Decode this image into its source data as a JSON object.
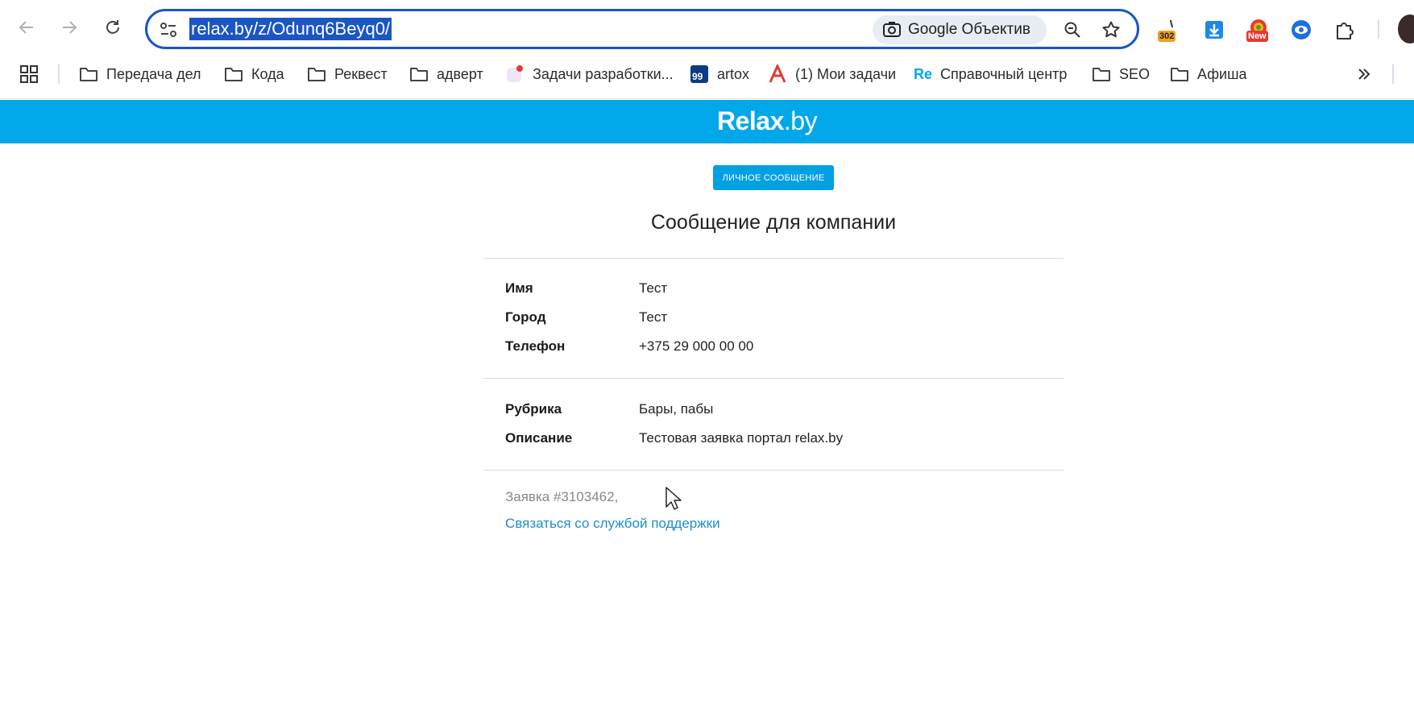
{
  "browser": {
    "url": "relax.by/z/Odunq6Beyq0/",
    "lens_label": "Google Объектив",
    "extensions": [
      {
        "name": "timer-extension",
        "badge": "302",
        "badge_color": "#f0a020"
      },
      {
        "name": "download-extension"
      },
      {
        "name": "new-extension",
        "badge": "New",
        "badge_color": "#e53935"
      },
      {
        "name": "eye-extension"
      },
      {
        "name": "puzzle-extension"
      }
    ]
  },
  "bookmarks": [
    {
      "label": "Передача дел",
      "icon": "folder-icon"
    },
    {
      "label": "Кода",
      "icon": "folder-icon"
    },
    {
      "label": "Реквест",
      "icon": "folder-icon"
    },
    {
      "label": "адверт",
      "icon": "folder-icon"
    },
    {
      "label": "Задачи разработки...",
      "icon": "task-app-icon"
    },
    {
      "label": "artox",
      "icon": "artox-icon"
    },
    {
      "label": "(1) Мои задачи",
      "icon": "a-logo-icon"
    },
    {
      "label": "Справочный центр",
      "icon": "re-logo-icon"
    },
    {
      "label": "SEO",
      "icon": "folder-icon"
    },
    {
      "label": "Афиша",
      "icon": "folder-icon"
    }
  ],
  "artox_badge": "99",
  "re_logo": "Re",
  "site": {
    "logo_bold": "Relax",
    "logo_light": ".by",
    "badge": "ЛИЧНОЕ СООБЩЕНИЕ",
    "title": "Сообщение для компании",
    "contact_rows": [
      {
        "key": "Имя",
        "value": "Тест"
      },
      {
        "key": "Город",
        "value": "Тест"
      },
      {
        "key": "Телефон",
        "value": "+375 29 000 00 00"
      }
    ],
    "detail_rows": [
      {
        "key": "Рубрика",
        "value": "Бары, пабы"
      },
      {
        "key": "Описание",
        "value": "Тестовая заявка портал relax.by"
      }
    ],
    "order_text": "Заявка #3103462,",
    "support_link": "Связаться со службой поддержки"
  },
  "colors": {
    "brand": "#00a8ea",
    "link": "#1c8ec9",
    "omnibox_border": "#1a56c4"
  }
}
